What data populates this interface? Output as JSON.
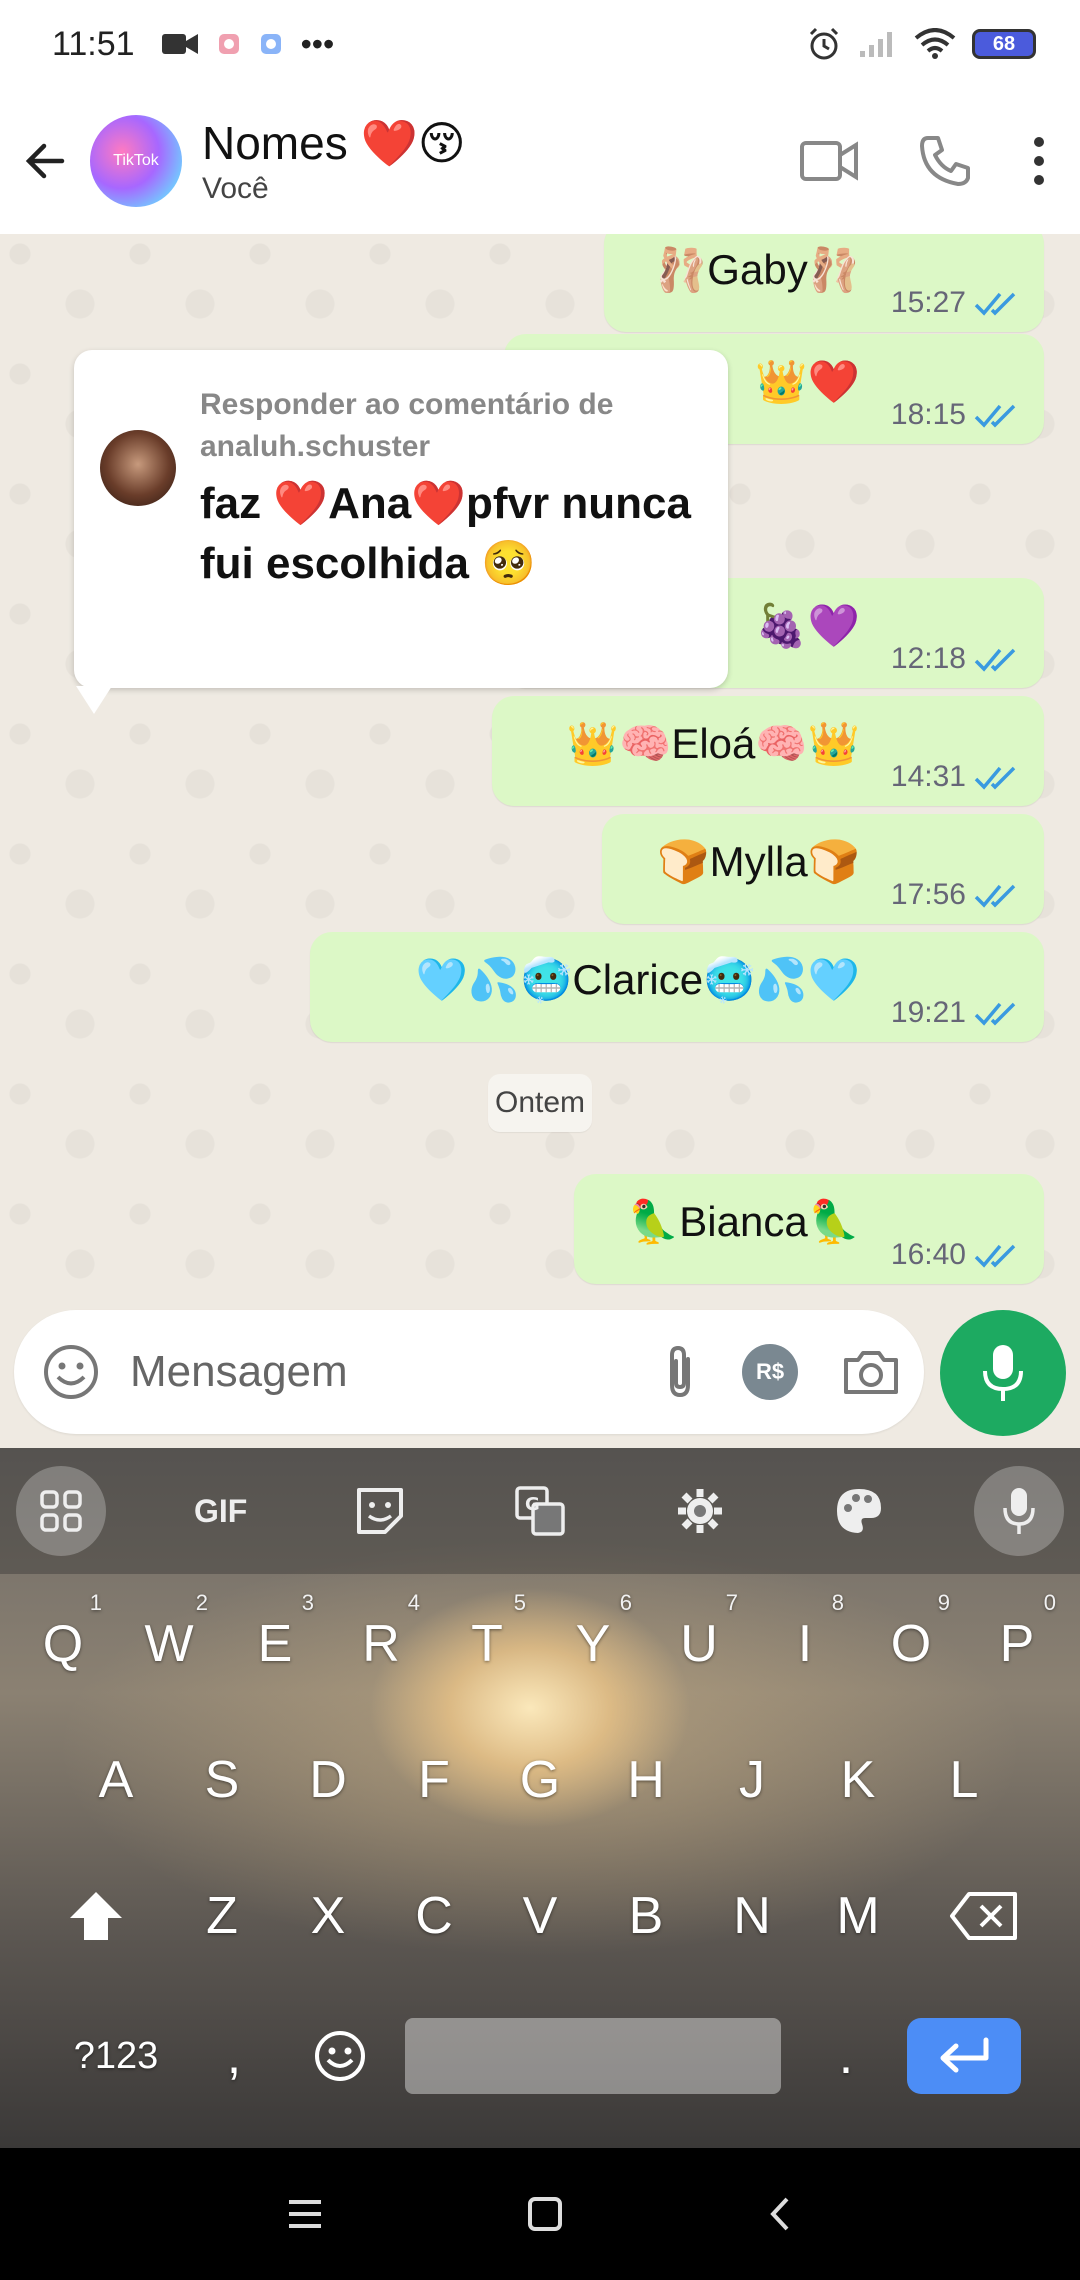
{
  "status_bar": {
    "time": "11:51",
    "more": "•••",
    "battery": "68"
  },
  "header": {
    "title": "Nomes ❤️😚",
    "subtitle": "Você",
    "avatar_text": "TikTok"
  },
  "messages": [
    {
      "text": "🩰Gaby🩰",
      "time": "15:27"
    },
    {
      "text": "👑❤️",
      "time": "18:15"
    },
    {
      "text": "🍇💜",
      "time": "12:18"
    },
    {
      "text": "👑🧠Eloá🧠👑",
      "time": "14:31"
    },
    {
      "text": "🍞Mylla🍞",
      "time": "17:56"
    },
    {
      "text": "🩵💦🥶Clarice🥶💦🩵",
      "time": "19:21"
    },
    {
      "text": "🦜Bianca🦜",
      "time": "16:40"
    }
  ],
  "date_chip": "Ontem",
  "reply_card": {
    "label": "Responder ao comentário de analuh.schuster",
    "comment": "faz ❤️Ana❤️pfvr nunca fui escolhida 🥺"
  },
  "composer": {
    "placeholder": "Mensagem",
    "payment_label": "R$"
  },
  "keyboard": {
    "toolbar": {
      "gif": "GIF"
    },
    "row1": [
      {
        "key": "Q",
        "hint": "1"
      },
      {
        "key": "W",
        "hint": "2"
      },
      {
        "key": "E",
        "hint": "3"
      },
      {
        "key": "R",
        "hint": "4"
      },
      {
        "key": "T",
        "hint": "5"
      },
      {
        "key": "Y",
        "hint": "6"
      },
      {
        "key": "U",
        "hint": "7"
      },
      {
        "key": "I",
        "hint": "8"
      },
      {
        "key": "O",
        "hint": "9"
      },
      {
        "key": "P",
        "hint": "0"
      }
    ],
    "row2": [
      "A",
      "S",
      "D",
      "F",
      "G",
      "H",
      "J",
      "K",
      "L"
    ],
    "row3": [
      "Z",
      "X",
      "C",
      "V",
      "B",
      "N",
      "M"
    ],
    "bottom": {
      "symbols": "?123",
      "comma": ",",
      "period": "."
    }
  }
}
